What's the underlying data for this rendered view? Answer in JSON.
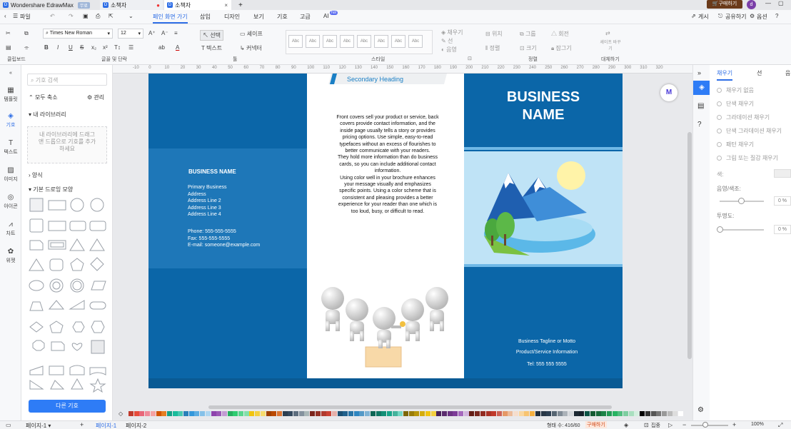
{
  "tabs": [
    {
      "label": "Wondershare EdrawMax",
      "badge": "무료"
    },
    {
      "label": "소책자"
    },
    {
      "label": "소책자"
    }
  ],
  "buy_button": "구매하기",
  "avatar": "d",
  "menu": {
    "file": "파일",
    "items": [
      "페인 화면 가기",
      "삽입",
      "디자인",
      "보기",
      "기호",
      "고급",
      "AI"
    ],
    "ai_badge": "hot",
    "right": [
      "게시",
      "공유하기",
      "옵션"
    ]
  },
  "ribbon": {
    "font_name": "Times New Roman",
    "font_size": "12",
    "groups": [
      "클립보드",
      "글꼴 및 단락",
      "툴",
      "스타일",
      "정렬",
      "대체하기"
    ],
    "tools": {
      "select": "선택",
      "shape": "셰이프",
      "text": "텍스트",
      "connector": "커넥터"
    },
    "style_items": [
      "채우기",
      "선",
      "음영"
    ],
    "arrange_items": [
      "위치",
      "그룹",
      "회전",
      "정렬",
      "크기",
      "잠그기"
    ],
    "replace": "셰이프 바꾸기",
    "abc": "Abc"
  },
  "leftnav": [
    "템플릿",
    "기호",
    "텍스트",
    "이미지",
    "아이콘",
    "차트",
    "위젯"
  ],
  "library": {
    "search_placeholder": "기호 검색",
    "collapse_all": "모두 축소",
    "manage": "관리",
    "my_library": "내 라이브러리",
    "drop_hint": "내 라이브러리에 드래그 앤 드롭으로 기호를 추가하세요",
    "form": "양식",
    "basic_shapes": "기본 드로잉 모양",
    "more_button": "다른 기호"
  },
  "ruler": [
    "-10",
    "0",
    "10",
    "20",
    "30",
    "40",
    "50",
    "60",
    "70",
    "80",
    "90",
    "100",
    "110",
    "120",
    "130",
    "140",
    "150",
    "160",
    "170",
    "180",
    "190",
    "200",
    "210",
    "220",
    "230",
    "240",
    "250",
    "260",
    "270",
    "280",
    "290",
    "300",
    "310",
    "320"
  ],
  "brochure": {
    "secondary_heading": "Secondary Heading",
    "body_text": "Front covers sell your product or service, back covers provide contact information, and the inside page usually tells a story or provides pricing options. Use simple, easy-to-read typefaces without an excess of flourishes to better communicate with your readers.\nThey hold more information than do business cards, so you can include additional contact information.\nUsing color well in your brochure enhances your message visually and emphasizes specific points. Using a color scheme that is consistent and pleasing provides a better experience for your reader than one which is too loud, busy, or difficult to read.",
    "left_name": "BUSINESS NAME",
    "address": [
      "Primary Business",
      "Address",
      "Address Line 2",
      "Address Line 3",
      "Address Line 4"
    ],
    "contact": [
      "Phone: 555-555-5555",
      "Fax: 555-555-5555",
      "E-mail: someone@example.com"
    ],
    "cover_name": "BUSINESS\nNAME",
    "tagline": "Business Tagline or Motto",
    "product": "Product/Service Information",
    "tel": "Tel: 555 555 5555",
    "colors": {
      "dark_blue": "#0b66a8",
      "panel_blue": "#1e77b8",
      "light_blue": "#bfe3f6"
    }
  },
  "right_panel": {
    "tabs": [
      "채우기",
      "선",
      "음"
    ],
    "options": [
      "채우기 없음",
      "단색 채우기",
      "그라데이션 채우기",
      "단색 그라데이션 채우기",
      "패턴 채우기",
      "그림 또는 질감 채우기"
    ],
    "color_label": "색:",
    "shade_label": "음영/색조:",
    "transparency_label": "투명도:",
    "percent": "0 %"
  },
  "status": {
    "pages": [
      "페이지-1",
      "페이지-1",
      "페이지-2"
    ],
    "shape_count": "형태 수: 416/60",
    "buy": "구매하기",
    "focus": "집중",
    "zoom": "100%"
  },
  "palette": [
    "#c0392b",
    "#e74c3c",
    "#e8677a",
    "#f08a9a",
    "#f5a3a3",
    "#d35400",
    "#e67e22",
    "#16a085",
    "#1abc9c",
    "#48c9b0",
    "#2980b9",
    "#3498db",
    "#5dade2",
    "#85c1e9",
    "#aed6f1",
    "#8e44ad",
    "#9b59b6",
    "#c39bd3",
    "#27ae60",
    "#2ecc71",
    "#58d68d",
    "#82e0aa",
    "#f1c40f",
    "#f4d03f",
    "#f7dc6f",
    "#a04000",
    "#ba4a00",
    "#dc7633",
    "#2c3e50",
    "#34495e",
    "#5d6d7e",
    "#85929e",
    "#aab7b8",
    "#7b241c",
    "#943126",
    "#b03a2e",
    "#cb4335",
    "#e6b0aa",
    "#1b4f72",
    "#21618c",
    "#2874a6",
    "#2e86c1",
    "#5499c7",
    "#7fb3d5",
    "#0e6655",
    "#117864",
    "#148f77",
    "#17a589",
    "#45b39d",
    "#76d7c4",
    "#7d6608",
    "#9a7d0a",
    "#b7950b",
    "#d4ac0d",
    "#f1c40f",
    "#f4d03f",
    "#4a235a",
    "#5b2c6f",
    "#6c3483",
    "#7d3c98",
    "#a569bd",
    "#d2b4de",
    "#641e16",
    "#78281f",
    "#922b21",
    "#a93226",
    "#c0392b",
    "#cd6155",
    "#e59866",
    "#edbb99",
    "#f6ddcc",
    "#fad7a0",
    "#f8c471",
    "#f5b041",
    "#212f3d",
    "#283747",
    "#2e4053",
    "#566573",
    "#808b96",
    "#abb2b9",
    "#d5d8dc",
    "#1c2833",
    "#17202a",
    "#0b5345",
    "#145a32",
    "#186a3b",
    "#1d8348",
    "#239b56",
    "#28b463",
    "#52be80",
    "#7dcea0",
    "#a9dfbf",
    "#d4efdf",
    "#000000",
    "#333333",
    "#555555",
    "#777777",
    "#999999",
    "#bbbbbb",
    "#dddddd",
    "#ffffff"
  ]
}
